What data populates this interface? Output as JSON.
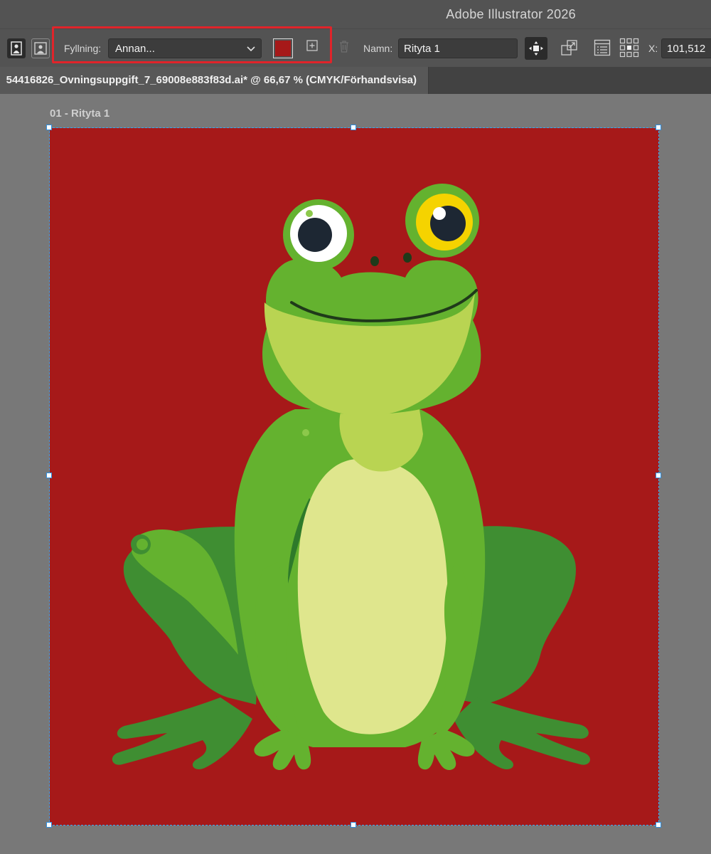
{
  "window": {
    "app_title": "Adobe Illustrator 2026"
  },
  "control_bar": {
    "fill_label": "Fyllning:",
    "fill_value": "Annan...",
    "fill_color": "#a61919",
    "name_label": "Namn:",
    "name_value": "Rityta 1",
    "x_label": "X:",
    "x_value": "101,512",
    "icons": [
      "portrait-mode-icon",
      "landscape-mode-icon",
      "chevron-down-icon",
      "new-artboard-icon",
      "delete-artboard-icon",
      "move-with-artboard-icon",
      "artboard-options-icon",
      "artboard-panel-icon",
      "reference-point-icon"
    ]
  },
  "document_tab": {
    "title": "54416826_Ovningsuppgift_7_69008e883f83d.ai* @ 66,67 % (CMYK/Förhandsvisa)"
  },
  "canvas": {
    "artboard_label": "01 - Rityta 1",
    "artboard_color": "#a61919",
    "artwork": "frog-illustration"
  }
}
